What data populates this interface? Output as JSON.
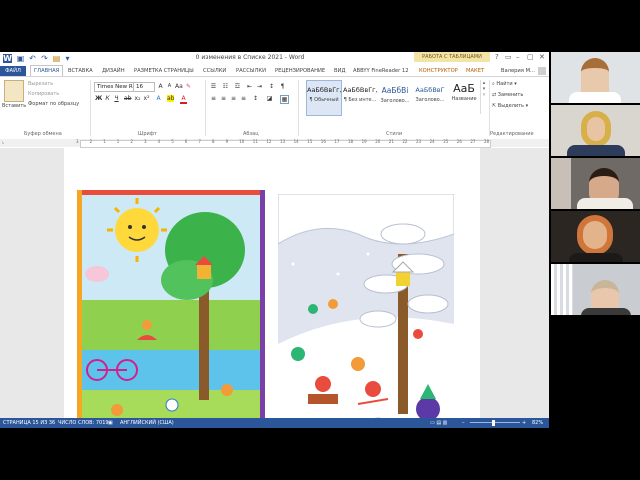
{
  "window": {
    "title": "0 изменения в Списке 2021 - Word",
    "context_title": "РАБОТА С ТАБЛИЦАМИ",
    "controls": [
      "?",
      "▭",
      "–",
      "▢",
      "✕"
    ]
  },
  "tabs": [
    {
      "label": "ФАЙЛ"
    },
    {
      "label": "ГЛАВНАЯ"
    },
    {
      "label": "ВСТАВКА"
    },
    {
      "label": "ДИЗАЙН"
    },
    {
      "label": "РАЗМЕТКА СТРАНИЦЫ"
    },
    {
      "label": "ССЫЛКИ"
    },
    {
      "label": "РАССЫЛКИ"
    },
    {
      "label": "РЕЦЕНЗИРОВАНИЕ"
    },
    {
      "label": "ВИД"
    },
    {
      "label": "ABBYY FineReader 12"
    },
    {
      "label": "КОНСТРУКТОР"
    },
    {
      "label": "МАКЕТ"
    }
  ],
  "user": "Валерия М...",
  "clipboard": {
    "paste": "Вставить",
    "cut": "Вырезать",
    "copy": "Копировать",
    "format_painter": "Формат по образцу",
    "group": "Буфер обмена"
  },
  "font": {
    "name": "Times New R",
    "size": "16",
    "group": "Шрифт"
  },
  "paragraph": {
    "group": "Абзац"
  },
  "styles": {
    "group": "Стили",
    "items": [
      {
        "preview": "АаБбВвГг,",
        "name": "¶ Обычный"
      },
      {
        "preview": "АаБбВвГг,",
        "name": "¶ Без инте..."
      },
      {
        "preview": "АаБбВі",
        "name": "Заголово..."
      },
      {
        "preview": "АаБбВвГ",
        "name": "Заголово..."
      },
      {
        "preview": "АаБ",
        "name": "Название"
      }
    ]
  },
  "editing": {
    "find": "Найти",
    "replace": "Заменить",
    "select": "Выделить",
    "group": "Редактирование"
  },
  "ruler_numbers": [
    "3",
    "2",
    "1",
    "1",
    "2",
    "3",
    "4",
    "5",
    "6",
    "7",
    "8",
    "9",
    "10",
    "11",
    "12",
    "13",
    "14",
    "15",
    "16",
    "17",
    "18",
    "19",
    "20",
    "21",
    "22",
    "23",
    "24",
    "25",
    "26",
    "27",
    "28"
  ],
  "status": {
    "page": "СТРАНИЦА 15 ИЗ 36",
    "words": "ЧИСЛО СЛОВ: 7019",
    "language": "АНГЛИЙСКИЙ (США)",
    "zoom": "82%"
  },
  "images": {
    "summer": "summer-park-illustration",
    "winter": "winter-snow-illustration"
  },
  "participants": [
    {
      "name": "participant-1",
      "bg": "#dfe3e6"
    },
    {
      "name": "participant-2",
      "bg": "#d9d6cf"
    },
    {
      "name": "participant-3",
      "bg": "#6f6a66"
    },
    {
      "name": "participant-4",
      "bg": "#2b2622"
    },
    {
      "name": "participant-5",
      "bg": "#c9cdd1"
    }
  ],
  "colors": {
    "accent": "#2b579a",
    "context": "#f3e3a6"
  }
}
